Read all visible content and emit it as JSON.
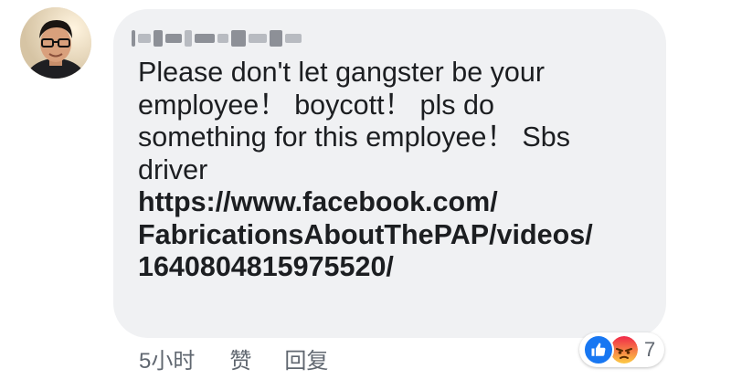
{
  "comment": {
    "author_name": "",
    "lines": [
      "Please don't let gangster be your",
      "employee！ boycott！ pls do",
      "something for this employee！ Sbs",
      "driver"
    ],
    "link_lines": [
      "https://www.facebook.com/",
      "FabricationsAboutThePAP/videos/",
      "1640804815975520/"
    ]
  },
  "actions": {
    "time": "5小时",
    "like_label": "赞",
    "reply_label": "回复"
  },
  "reactions": {
    "icons": [
      "like-icon",
      "angry-icon"
    ],
    "count": "7",
    "colors": {
      "like": "#1877f2",
      "angry_top": "#f02849",
      "angry_bottom": "#fcc444"
    }
  },
  "colors": {
    "bubble": "#f0f1f3",
    "text": "#1c1e21",
    "meta": "#606770"
  }
}
